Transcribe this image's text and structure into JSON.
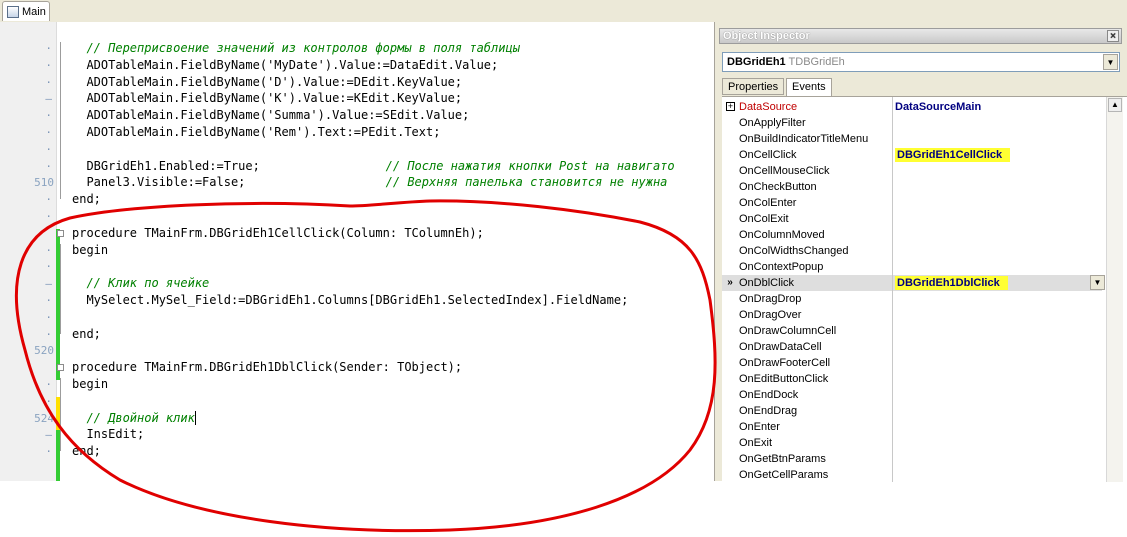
{
  "tab": {
    "label": "Main"
  },
  "editor": {
    "line_numbers": [
      {
        "row": 1,
        "text": "510"
      },
      {
        "row": 20,
        "text": "520"
      },
      {
        "row": 24,
        "text": "524"
      }
    ],
    "lines": [
      {
        "text": "  // Переприсвоение значений из контролов формы в поля таблицы",
        "type": "comment"
      },
      {
        "text": "  ADOTableMain.FieldByName('MyDate').Value:=DataEdit.Value;",
        "type": "code"
      },
      {
        "text": "  ADOTableMain.FieldByName('D').Value:=DEdit.KeyValue;",
        "type": "code"
      },
      {
        "text": "  ADOTableMain.FieldByName('K').Value:=KEdit.KeyValue;",
        "type": "code"
      },
      {
        "text": "  ADOTableMain.FieldByName('Summa').Value:=SEdit.Value;",
        "type": "code"
      },
      {
        "text": "  ADOTableMain.FieldByName('Rem').Text:=PEdit.Text;",
        "type": "code"
      },
      {
        "text": "",
        "type": "code"
      },
      {
        "text": "  DBGridEh1.Enabled:=True;",
        "comment": "// После нажатия кнопки Post на навигато",
        "type": "mixed"
      },
      {
        "text": "  Panel3.Visible:=False;  ",
        "comment": "// Верхняя панелька становится не нужна",
        "type": "mixed"
      },
      {
        "text": "end;",
        "type": "code"
      },
      {
        "text": "",
        "type": "code"
      },
      {
        "text": "procedure TMainFrm.DBGridEh1CellClick(Column: TColumnEh);",
        "type": "code"
      },
      {
        "text": "begin",
        "type": "code"
      },
      {
        "text": "",
        "type": "code"
      },
      {
        "text": "  // Клик по ячейке",
        "type": "comment"
      },
      {
        "text": "  MySelect.MySel_Field:=DBGridEh1.Columns[DBGridEh1.SelectedIndex].FieldName;",
        "type": "code"
      },
      {
        "text": "",
        "type": "code"
      },
      {
        "text": "end;",
        "type": "code"
      },
      {
        "text": "",
        "type": "code"
      },
      {
        "text": "procedure TMainFrm.DBGridEh1DblClick(Sender: TObject);",
        "type": "code"
      },
      {
        "text": "begin",
        "type": "code"
      },
      {
        "text": "",
        "type": "code"
      },
      {
        "text": "  // Двойной клик",
        "type": "comment"
      },
      {
        "text": "  InsEdit;",
        "type": "code"
      },
      {
        "text": "end;",
        "type": "code"
      }
    ]
  },
  "inspector": {
    "title": "Object Inspector",
    "close": "×",
    "object_name": "DBGridEh1",
    "object_type": "TDBGridEh",
    "tabs": [
      "Properties",
      "Events"
    ],
    "active_tab": "Events",
    "rows": [
      {
        "name": "DataSource",
        "value": "DataSourceMain",
        "expand": true,
        "red": true
      },
      {
        "name": "OnApplyFilter",
        "value": ""
      },
      {
        "name": "OnBuildIndicatorTitleMenu",
        "value": ""
      },
      {
        "name": "OnCellClick",
        "value": "DBGridEh1CellClick",
        "highlight": true
      },
      {
        "name": "OnCellMouseClick",
        "value": ""
      },
      {
        "name": "OnCheckButton",
        "value": ""
      },
      {
        "name": "OnColEnter",
        "value": ""
      },
      {
        "name": "OnColExit",
        "value": ""
      },
      {
        "name": "OnColumnMoved",
        "value": ""
      },
      {
        "name": "OnColWidthsChanged",
        "value": ""
      },
      {
        "name": "OnContextPopup",
        "value": ""
      },
      {
        "name": "OnDblClick",
        "value": "DBGridEh1DblClick",
        "highlight": true,
        "selected": true,
        "indicator": "»"
      },
      {
        "name": "OnDragDrop",
        "value": ""
      },
      {
        "name": "OnDragOver",
        "value": ""
      },
      {
        "name": "OnDrawColumnCell",
        "value": ""
      },
      {
        "name": "OnDrawDataCell",
        "value": ""
      },
      {
        "name": "OnDrawFooterCell",
        "value": ""
      },
      {
        "name": "OnEditButtonClick",
        "value": ""
      },
      {
        "name": "OnEndDock",
        "value": ""
      },
      {
        "name": "OnEndDrag",
        "value": ""
      },
      {
        "name": "OnEnter",
        "value": ""
      },
      {
        "name": "OnExit",
        "value": ""
      },
      {
        "name": "OnGetBtnParams",
        "value": ""
      },
      {
        "name": "OnGetCellParams",
        "value": ""
      }
    ]
  },
  "colors": {
    "highlight": "#ffff33",
    "annotation": "#e00000",
    "modified_green": "#33cc33",
    "modified_yellow": "#ffe000"
  }
}
